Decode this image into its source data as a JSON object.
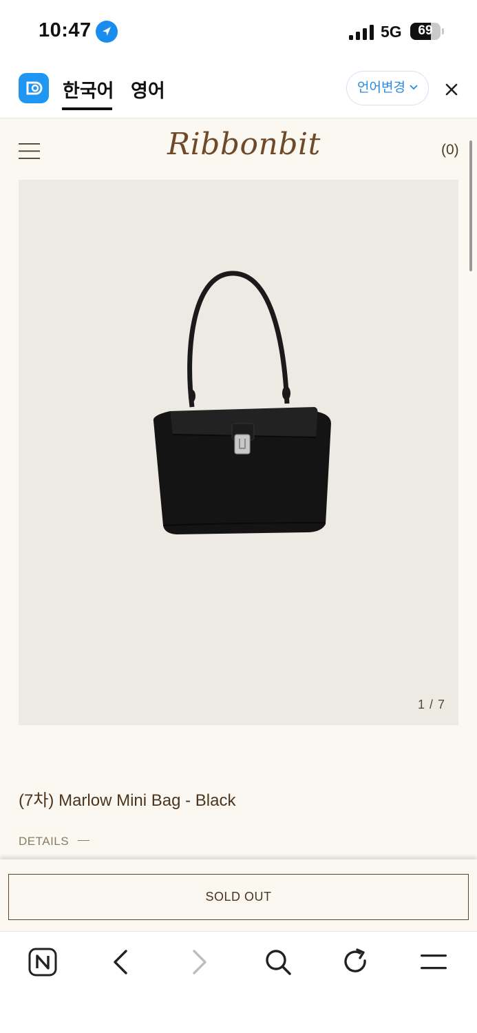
{
  "status_bar": {
    "time": "10:47",
    "network": "5G",
    "battery_percent": 69,
    "battery_label": "69",
    "icons": [
      "location-arrow-icon",
      "signal-bars-icon",
      "battery-icon"
    ]
  },
  "translate_bar": {
    "tabs": [
      {
        "label": "한국어",
        "active": true
      },
      {
        "label": "영어",
        "active": false
      }
    ],
    "change_language_label": "언어변경",
    "accent_color": "#1e96f2",
    "icons": [
      "papago-logo-icon",
      "chevron-down-icon",
      "close-icon"
    ]
  },
  "page": {
    "header": {
      "logo": "Ribbonbit",
      "cart_count": "(0)",
      "icons": [
        "hamburger-menu-icon"
      ]
    },
    "gallery": {
      "counter": "1 / 7",
      "image_alt_icon": "black-shoulder-bag-image"
    },
    "product": {
      "title": "(7차) Marlow Mini Bag - Black",
      "details_label": "DETAILS"
    },
    "sold_out_label": "SOLD OUT",
    "colors": {
      "background": "#faf8f0",
      "brand_brown": "#6e4a2b",
      "image_bg": "#edeae4"
    }
  },
  "bottom_nav": {
    "icons": [
      "naver-n-icon",
      "back-arrow-icon",
      "forward-arrow-icon",
      "search-icon",
      "refresh-icon",
      "menu-icon"
    ]
  }
}
